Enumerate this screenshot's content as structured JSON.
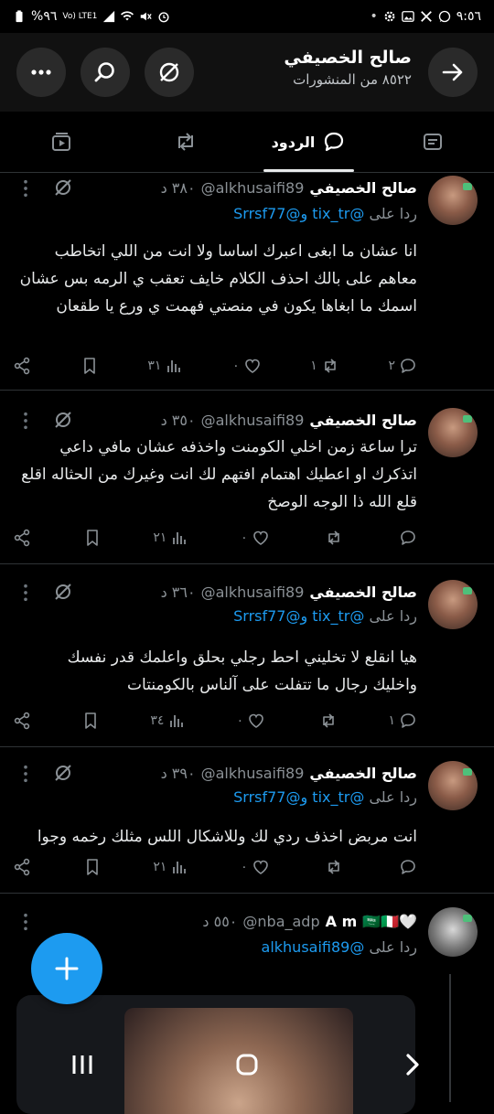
{
  "status_bar": {
    "time": "٩:٥٦",
    "battery": "%٩٦",
    "network": "Vo) LTE1"
  },
  "header": {
    "name": "صالح الخصيفي",
    "posts_count": "٨٥٢٢ من المنشورات"
  },
  "tabs": [
    {
      "label": "",
      "icon": "article-icon"
    },
    {
      "label": "الردود",
      "icon": "reply-bubble-icon"
    },
    {
      "label": "",
      "icon": "repost-icon"
    },
    {
      "label": "",
      "icon": "video-icon"
    }
  ],
  "tweets": [
    {
      "name": "صالح الخصيفي",
      "handle": "@alkhusaifi89",
      "time": "٣٨٠ د",
      "reply_prefix": "ردا على",
      "reply_to": "@tix_tr و@Srrsf77",
      "text": "انا عشان ما ابغى اعبرك اساسا ولا انت من اللي اتخاطب معاهم على بالك احذف الكلام خايف تعقب ي الرمه بس عشان اسمك ما ابغاها يكون في منصتي فهمت ي ورع يا طقعان",
      "replies": "٢",
      "reposts": "١",
      "likes": "٠",
      "views": "٣١"
    },
    {
      "name": "صالح الخصيفي",
      "handle": "@alkhusaifi89",
      "time": "٣٥٠ د",
      "reply_prefix": "",
      "reply_to": "",
      "text": "ترا ساعة زمن اخلي الكومنت واخذفه عشان مافي داعي اتذكرك او اعطيك اهتمام افتهم لك انت وغيرك من الحثاله اقلع قلع الله ذا الوجه الوصخ",
      "replies": "",
      "reposts": "",
      "likes": "٠",
      "views": "٢١"
    },
    {
      "name": "صالح الخصيفي",
      "handle": "@alkhusaifi89",
      "time": "٣٦٠ د",
      "reply_prefix": "ردا على",
      "reply_to": "@tix_tr و@Srrsf77",
      "text": "هيا انقلع لا تخليني احط رجلي بحلق واعلمك قدر نفسك واخليك رجال ما تتفلت على آلناس بالكومنتات",
      "replies": "١",
      "reposts": "",
      "likes": "٠",
      "views": "٣٤"
    },
    {
      "name": "صالح الخصيفي",
      "handle": "@alkhusaifi89",
      "time": "٣٩٠ د",
      "reply_prefix": "ردا على",
      "reply_to": "@tix_tr و@Srrsf77",
      "text": "انت مربض اخذف ردي لك وللاشكال اللس مثلك رخمه وجوا",
      "replies": "",
      "reposts": "",
      "likes": "٠",
      "views": "٢١"
    },
    {
      "name": "A m",
      "name_emoji": "🇸🇦🇮🇹🤍",
      "handle": "@nba_adp",
      "time": "٥٥٠ د",
      "reply_prefix": "ردا على",
      "reply_to": "@alkhusaifi89",
      "text": "",
      "replies": "",
      "reposts": "",
      "likes": "",
      "views": ""
    }
  ],
  "colors": {
    "accent": "#1d9bf0",
    "background": "#000000",
    "header_bg": "#111111",
    "muted_text": "#8b9196"
  }
}
